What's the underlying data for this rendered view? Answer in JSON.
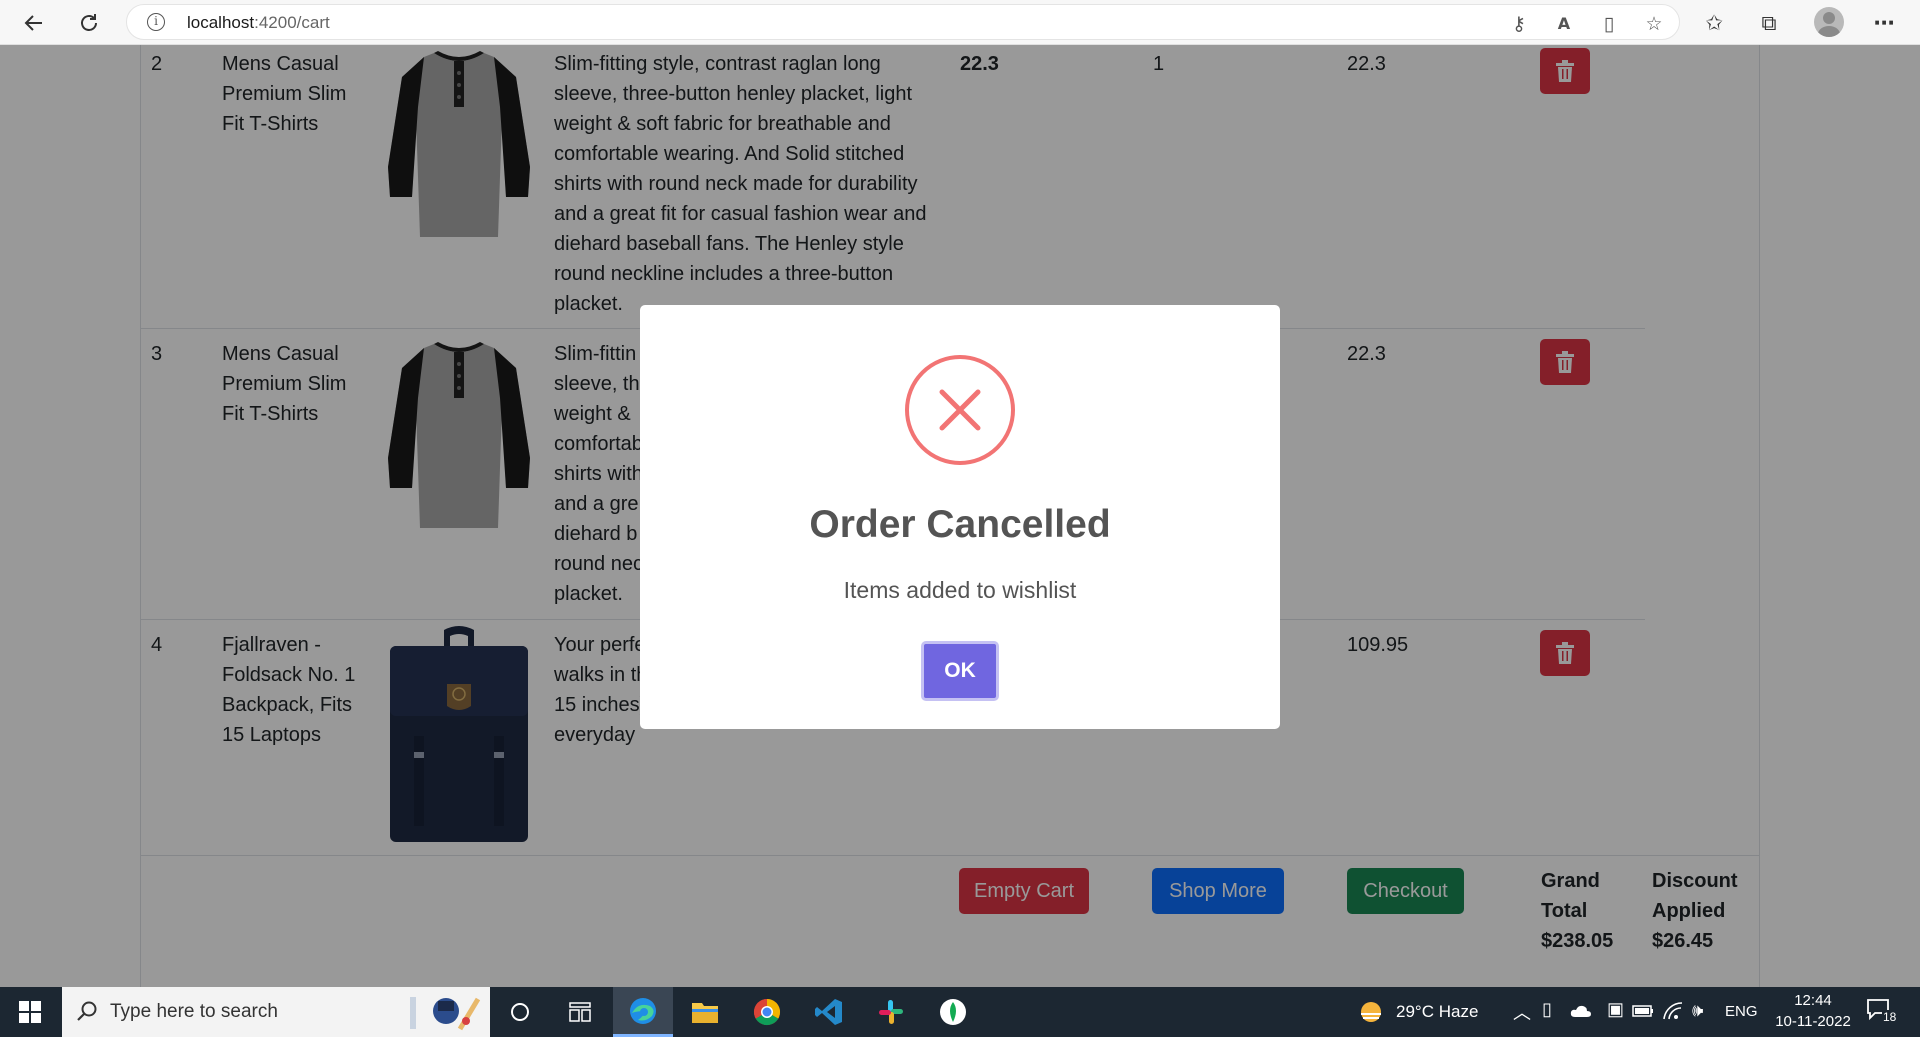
{
  "browser": {
    "url_host": "localhost",
    "url_path": ":4200/cart"
  },
  "cart": {
    "rows": [
      {
        "index": "2",
        "title": "Mens Casual Premium Slim Fit T-Shirts",
        "image": "tshirt",
        "description": "Slim-fitting style, contrast raglan long sleeve, three-button henley placket, light weight & soft fabric for breathable and comfortable wearing. And Solid stitched shirts with round neck made for durability and a great fit for casual fashion wear and diehard baseball fans. The Henley style round neckline includes a three-button placket.",
        "price": "22.3",
        "quantity": "1",
        "total": "22.3"
      },
      {
        "index": "3",
        "title": "Mens Casual Premium Slim Fit T-Shirts",
        "image": "tshirt",
        "description": "Slim-fittin sleeve, thr weight & comfortab shirts with and a gre diehard b round nec placket.",
        "price": "",
        "quantity": "",
        "total": "22.3"
      },
      {
        "index": "4",
        "title": "Fjallraven - Foldsack No. 1 Backpack, Fits 15 Laptops",
        "image": "backpack",
        "description": "Your perfe walks in th 15 inches) everyday",
        "price": "",
        "quantity": "",
        "total": "109.95"
      }
    ],
    "buttons": {
      "empty": "Empty Cart",
      "shop_more": "Shop More",
      "checkout": "Checkout"
    },
    "grand_total_label_1": "Grand",
    "grand_total_label_2": "Total",
    "grand_total_value": "$238.05",
    "discount_label_1": "Discount",
    "discount_label_2": "Applied",
    "discount_value": "$26.45"
  },
  "modal": {
    "title": "Order Cancelled",
    "text": "Items added to wishlist",
    "ok_label": "OK",
    "icon": "error-x-icon",
    "icon_color": "#f27474",
    "button_color": "#7066e0"
  },
  "taskbar": {
    "search_placeholder": "Type here to search",
    "weather": "29°C  Haze",
    "language": "ENG",
    "time": "12:44",
    "date": "10-11-2022",
    "notification_count": "18"
  }
}
